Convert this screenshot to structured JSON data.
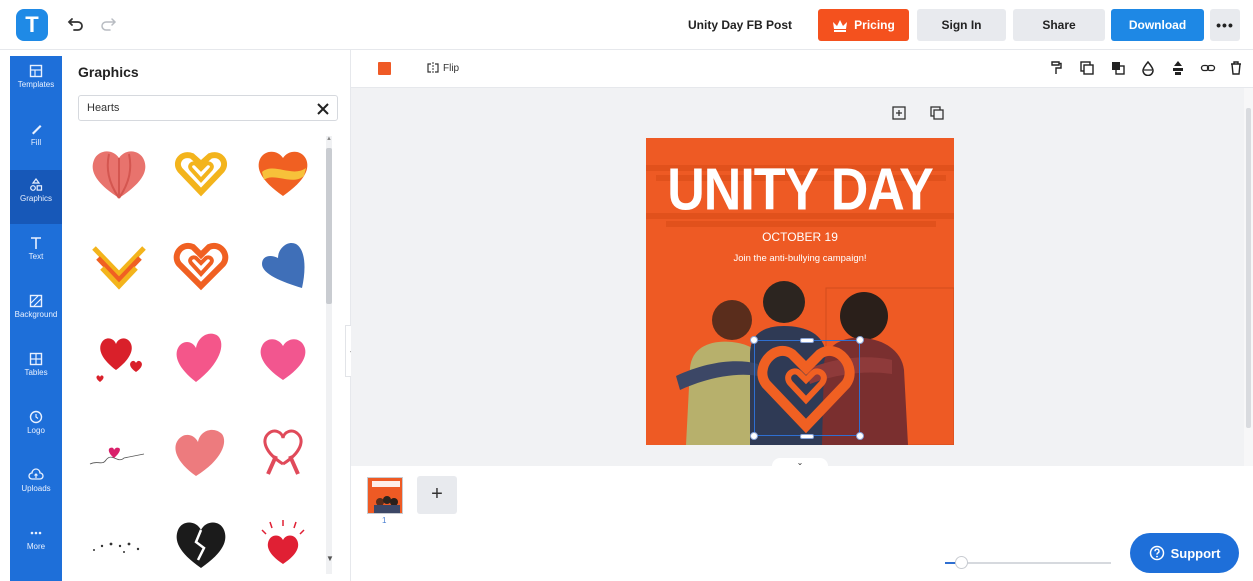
{
  "app": {
    "logo_letter": "T",
    "doc_title": "Unity Day FB Post"
  },
  "topbar": {
    "pricing": "Pricing",
    "signin": "Sign In",
    "share": "Share",
    "download": "Download",
    "more": "•••"
  },
  "rail": {
    "items": [
      {
        "label": "Templates",
        "icon": "templates-icon"
      },
      {
        "label": "Fill",
        "icon": "brush-icon"
      },
      {
        "label": "Graphics",
        "icon": "shapes-icon"
      },
      {
        "label": "Text",
        "icon": "text-icon"
      },
      {
        "label": "Background",
        "icon": "background-icon"
      },
      {
        "label": "Tables",
        "icon": "table-icon"
      },
      {
        "label": "Logo",
        "icon": "logo-icon"
      },
      {
        "label": "Uploads",
        "icon": "upload-cloud-icon"
      },
      {
        "label": "More",
        "icon": "more-dots-icon"
      }
    ],
    "active": "Graphics"
  },
  "panel": {
    "title": "Graphics",
    "search_value": "Hearts"
  },
  "editbar": {
    "flip": "Flip",
    "selected_color": "#ef5a26"
  },
  "artboard": {
    "title": "UNITY DAY",
    "date": "OCTOBER 19",
    "subtitle": "Join the anti-bullying campaign!",
    "background": "#ee5a24"
  },
  "pages": {
    "current": "1"
  },
  "support": {
    "label": "Support"
  }
}
